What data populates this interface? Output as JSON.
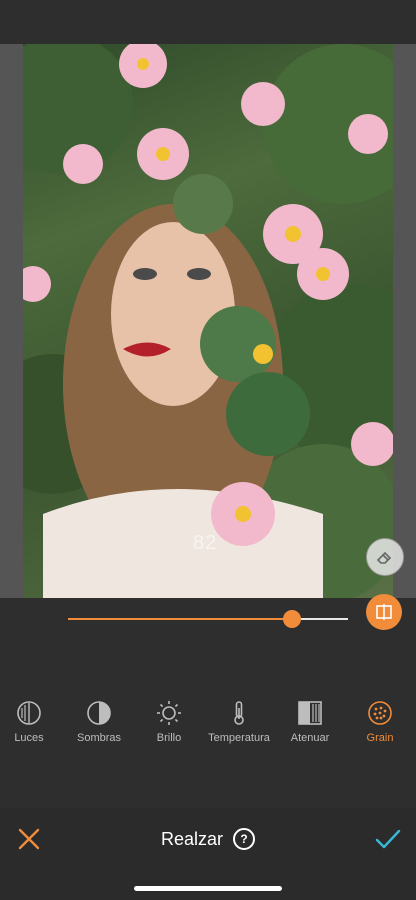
{
  "image": {
    "watermark": "82"
  },
  "slider": {
    "value_fraction": 0.8
  },
  "tools": [
    {
      "label": "Luces",
      "icon": "half-circle-lines-icon",
      "active": false
    },
    {
      "label": "Sombras",
      "icon": "half-circle-shadow-icon",
      "active": false
    },
    {
      "label": "Brillo",
      "icon": "sun-icon",
      "active": false
    },
    {
      "label": "Temperatura",
      "icon": "thermometer-icon",
      "active": false
    },
    {
      "label": "Atenuar",
      "icon": "fade-square-icon",
      "active": false
    },
    {
      "label": "Grain",
      "icon": "grain-icon",
      "active": true
    }
  ],
  "footer": {
    "title": "Realzar",
    "help": "?"
  },
  "colors": {
    "accent": "#f08c3a",
    "confirm": "#39b8d6",
    "background": "#2e2e2e"
  }
}
